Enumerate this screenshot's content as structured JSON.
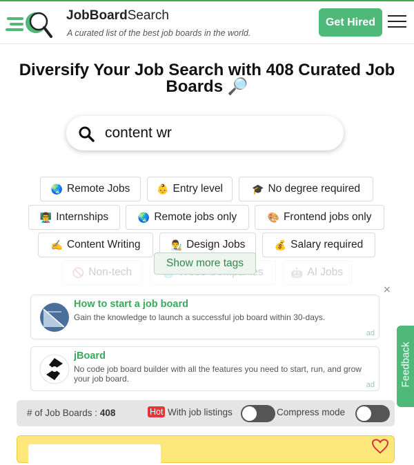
{
  "header": {
    "brand_bold": "JobBoard",
    "brand_light": "Search",
    "tagline": "A curated list of the best job boards in the world.",
    "cta_label": "Get Hired"
  },
  "hero": {
    "headline": "Diversify Your Job Search with 408 Curated Job Boards 🔎"
  },
  "search": {
    "value": "content wr"
  },
  "tags": [
    {
      "emoji": "🌏",
      "label": "Remote Jobs"
    },
    {
      "emoji": "👶",
      "label": "Entry level"
    },
    {
      "emoji": "🎓",
      "label": "No degree required"
    },
    {
      "emoji": "👨‍🏫",
      "label": "Internships"
    },
    {
      "emoji": "🌏",
      "label": "Remote jobs only"
    },
    {
      "emoji": "🎨",
      "label": "Frontend jobs only"
    },
    {
      "emoji": "✍️",
      "label": "Content Writing"
    },
    {
      "emoji": "👨‍🎨",
      "label": "Design Jobs"
    },
    {
      "emoji": "💰",
      "label": "Salary required"
    },
    {
      "emoji": "🚫",
      "label": "Non-tech"
    },
    {
      "emoji": "🌐",
      "label": "Web3 Companies"
    },
    {
      "emoji": "🤖",
      "label": "AI Jobs"
    }
  ],
  "show_more_label": "Show more tags",
  "ads": [
    {
      "title": "How to start a job board",
      "description": "Gain the knowledge to launch a successful job board within 30-days.",
      "label": "ad"
    },
    {
      "title": "jBoard",
      "description": "No code job board builder with all the features you need to start, run, and grow your job board.",
      "label": "ad"
    }
  ],
  "ad_close": "×",
  "feedback_label": "Feedback",
  "stats": {
    "count_label": "# of Job Boards :",
    "count_value": "408",
    "hot_badge": "Hot",
    "with_listings_label": "With job listings",
    "compress_label": "Compress mode",
    "with_listings_on": false,
    "compress_on": false
  },
  "colors": {
    "accent": "#4fb97a",
    "ad_title": "#3aa95a",
    "hot": "#e53535",
    "card_bg": "#fde67a"
  }
}
